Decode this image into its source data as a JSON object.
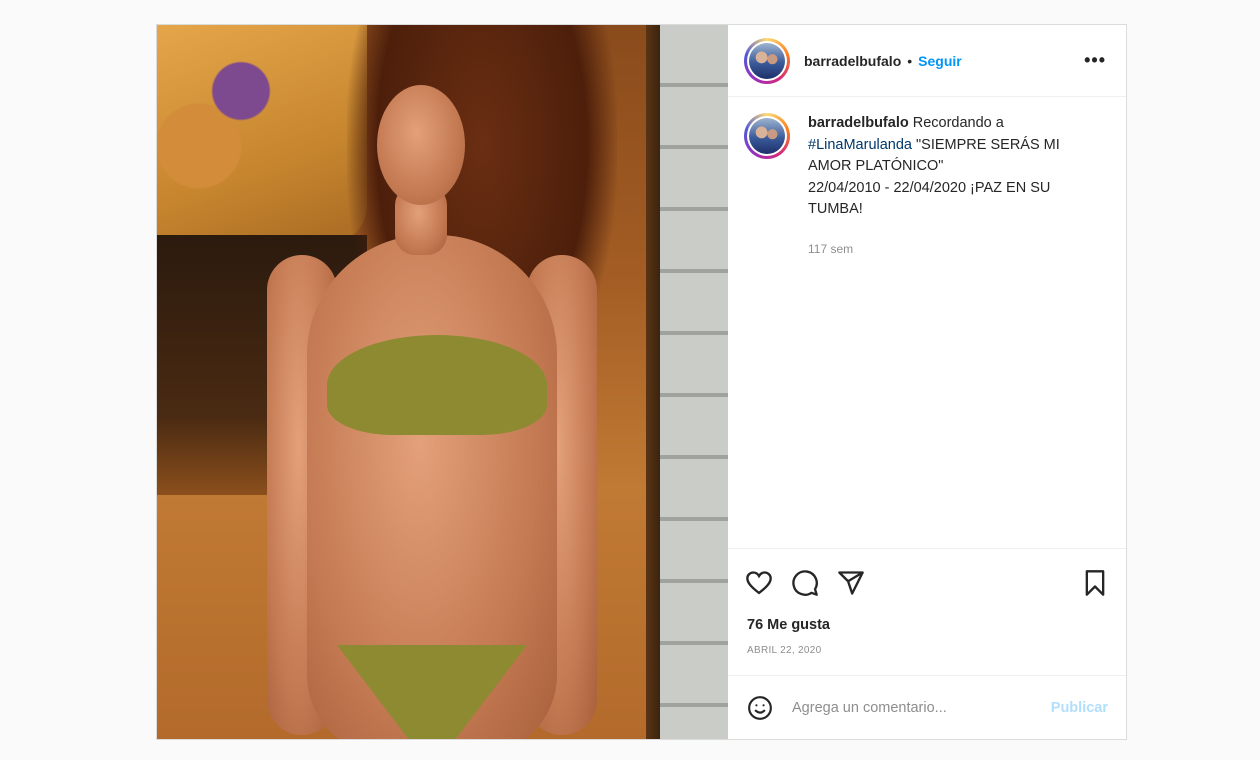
{
  "post": {
    "author": "barradelbufalo",
    "separator": "•",
    "follow_label": "Seguir",
    "more_label": "•••",
    "caption": {
      "username": "barradelbufalo",
      "text_prefix": "Recordando a",
      "hashtag": "#LinaMarulanda",
      "line_rest": "\"SIEMPRE SERÁS MI AMOR PLATÓNICO\"",
      "line_dates": "22/04/2010 - 22/04/2020 ¡PAZ EN SU TUMBA!",
      "time_ago": "117 sem"
    },
    "likes": "76 Me gusta",
    "date": "ABRIL 22, 2020",
    "comment": {
      "placeholder": "Agrega un comentario...",
      "publish_label": "Publicar"
    }
  },
  "icons": {
    "like": "heart-icon",
    "comment": "comment-bubble-icon",
    "share": "paper-plane-icon",
    "save": "bookmark-icon",
    "emoji": "smiley-icon"
  },
  "colors": {
    "link_blue": "#0095f6",
    "hashtag_blue": "#00376b",
    "muted": "#8e8e8e",
    "publish_disabled": "#b2dffc",
    "border": "#dbdbdb"
  }
}
